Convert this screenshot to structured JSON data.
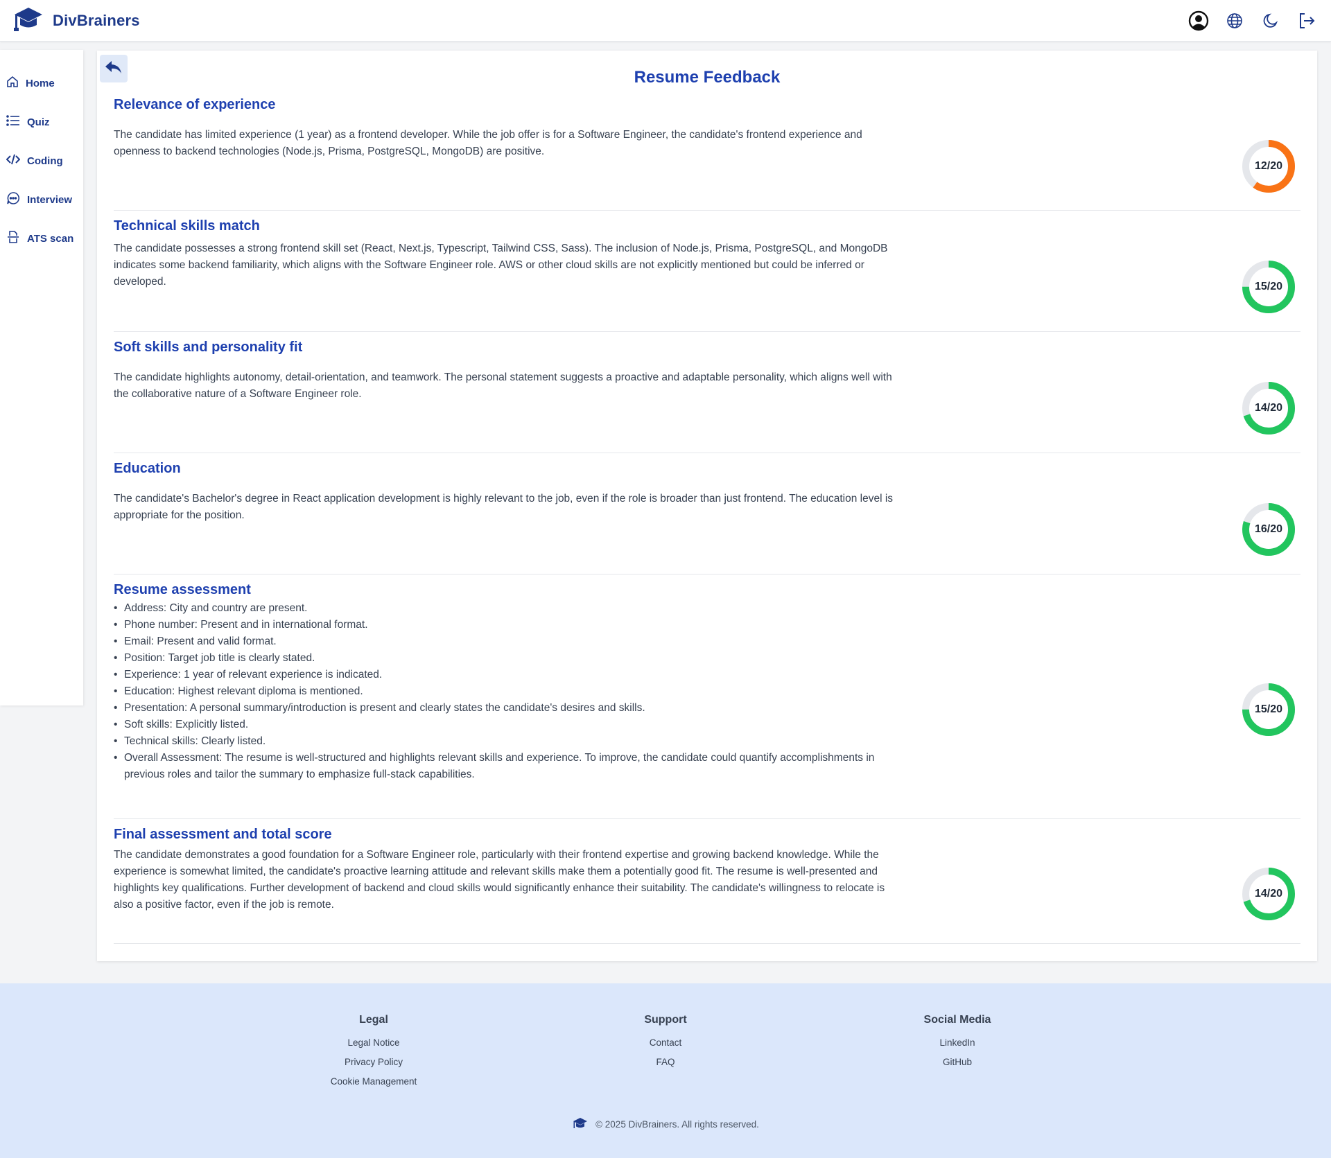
{
  "header": {
    "brand_name": "DivBrainers",
    "icons": [
      "graduation-cap-icon",
      "user-circle-icon",
      "globe-icon",
      "moon-icon",
      "logout-icon"
    ]
  },
  "sidebar": {
    "items": [
      {
        "label": "Home",
        "icon": "home-icon"
      },
      {
        "label": "Quiz",
        "icon": "list-icon"
      },
      {
        "label": "Coding",
        "icon": "code-icon"
      },
      {
        "label": "Interview",
        "icon": "chat-icon"
      },
      {
        "label": "ATS scan",
        "icon": "scan-icon"
      }
    ]
  },
  "main": {
    "title": "Resume Feedback",
    "back_icon": "reply-arrow-icon",
    "sections": [
      {
        "title": "Relevance of experience",
        "text": "The candidate has limited experience (1 year) as a frontend developer. While the job offer is for a Software Engineer, the candidate's frontend experience and openness to backend technologies (Node.js, Prisma, PostgreSQL, MongoDB) are positive.",
        "score_label": "12/20",
        "score": 12,
        "max": 20,
        "color": "#f97316"
      },
      {
        "title": "Technical skills match",
        "text": "The candidate possesses a strong frontend skill set (React, Next.js, Typescript, Tailwind CSS, Sass). The inclusion of Node.js, Prisma, PostgreSQL, and MongoDB indicates some backend familiarity, which aligns with the Software Engineer role. AWS or other cloud skills are not explicitly mentioned but could be inferred or developed.",
        "score_label": "15/20",
        "score": 15,
        "max": 20,
        "color": "#22c55e"
      },
      {
        "title": "Soft skills and personality fit",
        "text": "The candidate highlights autonomy, detail-orientation, and teamwork. The personal statement suggests a proactive and adaptable personality, which aligns well with the collaborative nature of a Software Engineer role.",
        "score_label": "14/20",
        "score": 14,
        "max": 20,
        "color": "#22c55e"
      },
      {
        "title": "Education",
        "text": "The candidate's Bachelor's degree in React application development is highly relevant to the job, even if the role is broader than just frontend. The education level is appropriate for the position.",
        "score_label": "16/20",
        "score": 16,
        "max": 20,
        "color": "#22c55e"
      },
      {
        "title": "Resume assessment",
        "bullets": [
          "Address: City and country are present.",
          "Phone number: Present and in international format.",
          "Email: Present and valid format.",
          "Position: Target job title is clearly stated.",
          "Experience: 1 year of relevant experience is indicated.",
          "Education: Highest relevant diploma is mentioned.",
          "Presentation: A personal summary/introduction is present and clearly states the candidate's desires and skills.",
          "Soft skills: Explicitly listed.",
          "Technical skills: Clearly listed.",
          "Overall Assessment: The resume is well-structured and highlights relevant skills and experience. To improve, the candidate could quantify accomplishments in previous roles and tailor the summary to emphasize full-stack capabilities."
        ],
        "score_label": "15/20",
        "score": 15,
        "max": 20,
        "color": "#22c55e"
      },
      {
        "title": "Final assessment and total score",
        "text": "The candidate demonstrates a good foundation for a Software Engineer role, particularly with their frontend expertise and growing backend knowledge. While the experience is somewhat limited, the candidate's proactive learning attitude and relevant skills make them a potentially good fit. The resume is well-presented and highlights key qualifications. Further development of backend and cloud skills would significantly enhance their suitability. The candidate's willingness to relocate is also a positive factor, even if the job is remote.",
        "score_label": "14/20",
        "score": 14,
        "max": 20,
        "color": "#22c55e"
      }
    ]
  },
  "footer": {
    "legal": {
      "title": "Legal",
      "links": [
        "Legal Notice",
        "Privacy Policy",
        "Cookie Management"
      ]
    },
    "support": {
      "title": "Support",
      "links": [
        "Contact",
        "FAQ"
      ]
    },
    "social": {
      "title": "Social Media",
      "links": [
        "LinkedIn",
        "GitHub"
      ]
    },
    "copyright": "© 2025 DivBrainers. All rights reserved."
  },
  "colors": {
    "brand": "#1e3a8a",
    "heading": "#1e40af",
    "score_orange": "#f97316",
    "score_green": "#22c55e",
    "footer_bg": "#dbe7fb"
  }
}
